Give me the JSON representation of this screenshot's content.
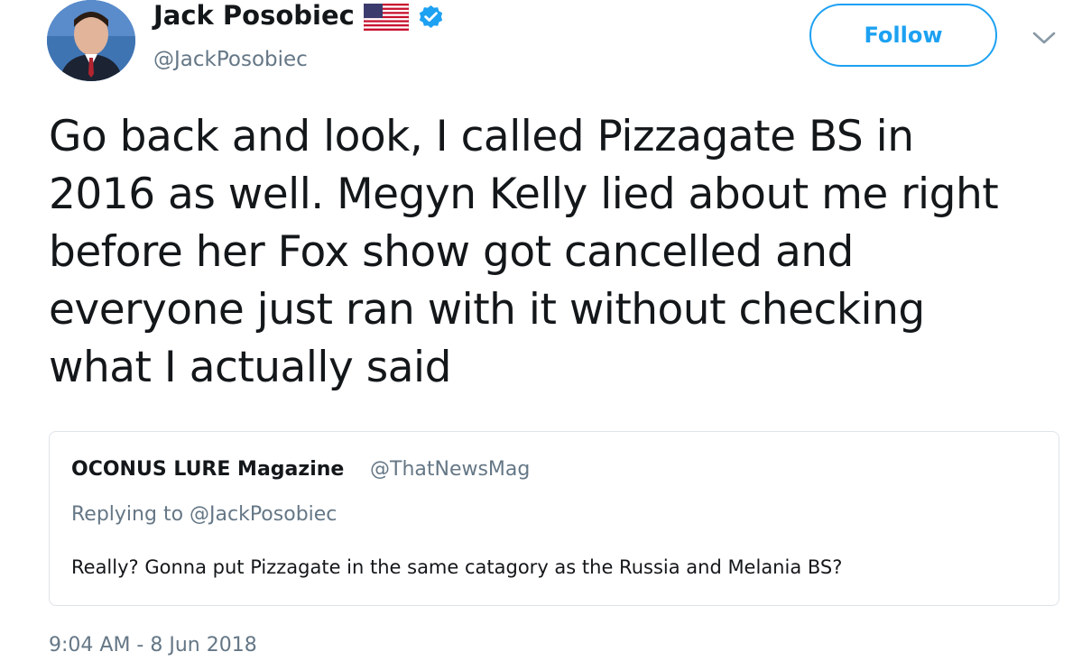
{
  "author": {
    "display_name": "Jack Posobiec",
    "handle": "@JackPosobiec",
    "flag_icon": "us-flag-icon",
    "verified_icon": "verified-badge-icon",
    "verified_color": "#1da1f2"
  },
  "actions": {
    "follow_label": "Follow",
    "menu_icon": "chevron-down-icon"
  },
  "tweet": {
    "text_lines": [
      "Go back and look, I called Pizzagate BS in",
      "2016 as well. Megyn Kelly lied about me right",
      "before her Fox show got cancelled and",
      "everyone just ran with it without checking",
      "what I actually said"
    ],
    "timestamp": "9:04 AM - 8 Jun 2018"
  },
  "quoted_tweet": {
    "name": "OCONUS LURE Magazine",
    "handle": "@ThatNewsMag",
    "replying_to": "Replying to @JackPosobiec",
    "text": "Really? Gonna put Pizzagate in the same catagory as the Russia and Melania BS?"
  },
  "colors": {
    "accent": "#1da1f2",
    "text": "#14171a",
    "muted": "#657786",
    "border": "#dfe4e9"
  }
}
